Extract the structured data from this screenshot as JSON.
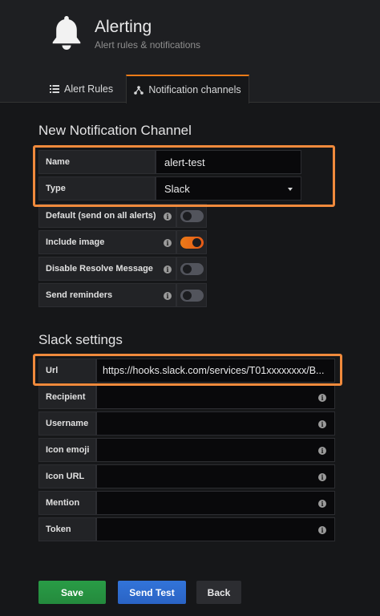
{
  "header": {
    "title": "Alerting",
    "subtitle": "Alert rules & notifications",
    "icon": "bell-icon"
  },
  "tabs": [
    {
      "label": "Alert Rules",
      "icon": "list-icon",
      "active": false
    },
    {
      "label": "Notification channels",
      "icon": "sitemap-icon",
      "active": true
    }
  ],
  "channel": {
    "section_title": "New Notification Channel",
    "name_label": "Name",
    "name_value": "alert-test",
    "type_label": "Type",
    "type_value": "Slack",
    "toggles": [
      {
        "label": "Default (send on all alerts)",
        "on": false
      },
      {
        "label": "Include image",
        "on": true
      },
      {
        "label": "Disable Resolve Message",
        "on": false
      },
      {
        "label": "Send reminders",
        "on": false
      }
    ]
  },
  "slack": {
    "section_title": "Slack settings",
    "url_label": "Url",
    "url_value": "https://hooks.slack.com/services/T01xxxxxxxx/B...",
    "fields": [
      {
        "label": "Recipient",
        "value": ""
      },
      {
        "label": "Username",
        "value": ""
      },
      {
        "label": "Icon emoji",
        "value": ""
      },
      {
        "label": "Icon URL",
        "value": ""
      },
      {
        "label": "Mention",
        "value": ""
      },
      {
        "label": "Token",
        "value": ""
      }
    ]
  },
  "actions": {
    "save": "Save",
    "send_test": "Send Test",
    "back": "Back"
  },
  "colors": {
    "accent": "#eb7b18",
    "highlight": "#f08a3c",
    "save": "#299c46",
    "send_test": "#3274d9"
  }
}
